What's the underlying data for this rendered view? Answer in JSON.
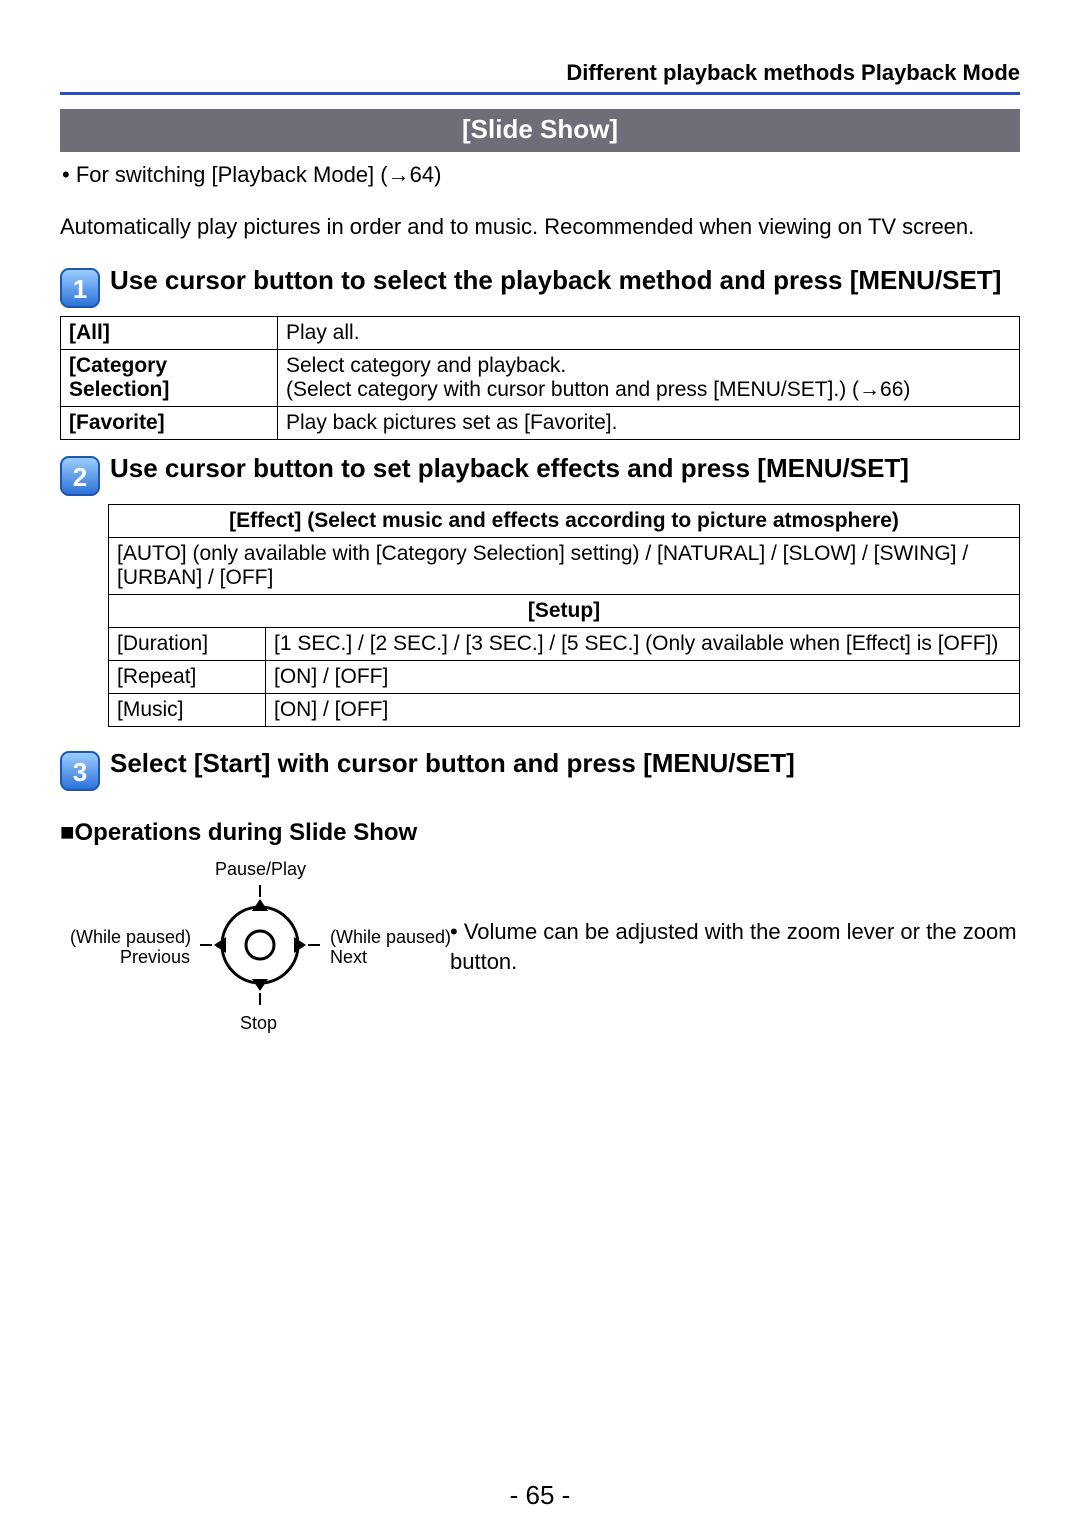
{
  "header": {
    "breadcrumb": "Different playback methods  Playback Mode"
  },
  "sectionTitle": "[Slide Show]",
  "switchNote": "• For switching [Playback Mode] (→64)",
  "intro": "Automatically play pictures in order and to music. Recommended when viewing on TV screen.",
  "steps": {
    "s1": "Use cursor button to select the playback method and press [MENU/SET]",
    "s2": "Use cursor button to set playback effects and press [MENU/SET]",
    "s3": "Select [Start] with cursor button and press [MENU/SET]"
  },
  "table1": {
    "r1k": "[All]",
    "r1v": "Play all.",
    "r2k": "[Category Selection]",
    "r2v": "Select category and playback.\n(Select category with cursor button and press [MENU/SET].) (→66)",
    "r3k": "[Favorite]",
    "r3v": "Play back pictures set as [Favorite]."
  },
  "table2": {
    "effectHeader": "[Effect] (Select music and effects according to picture atmosphere)",
    "effectBody": "[AUTO] (only available with [Category Selection] setting) / [NATURAL] / [SLOW] / [SWING] / [URBAN] / [OFF]",
    "setupHeader": "[Setup]",
    "durK": "[Duration]",
    "durV": "[1 SEC.] / [2 SEC.] / [3 SEC.] / [5 SEC.] (Only available when [Effect] is [OFF])",
    "repK": "[Repeat]",
    "repV": "[ON] / [OFF]",
    "musK": "[Music]",
    "musV": "[ON] / [OFF]"
  },
  "opsHeading": "■Operations during Slide Show",
  "dpad": {
    "up": "Pause/Play",
    "leftA": "(While paused)",
    "leftB": "Previous",
    "rightA": "(While paused)",
    "rightB": "Next",
    "down": "Stop"
  },
  "opsNote": "• Volume can be adjusted with the zoom lever or the zoom button.",
  "pageNumber": "- 65 -"
}
